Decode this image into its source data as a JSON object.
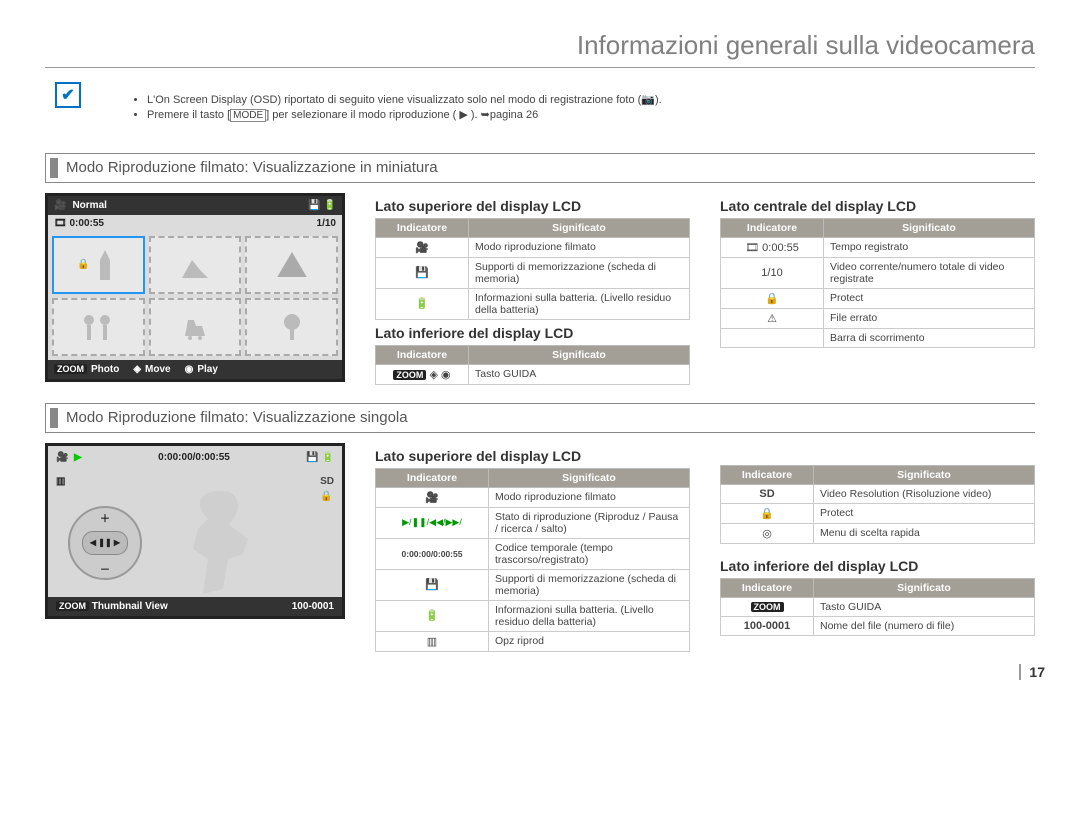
{
  "header": "Informazioni generali sulla videocamera",
  "notes": {
    "l1": "L'On Screen Display (OSD) riportato di seguito viene visualizzato solo nel modo di registrazione foto (📷).",
    "l2_a": "Premere il tasto [",
    "l2_mode": "MODE",
    "l2_b": "] per selezionare il modo riproduzione ( ▶ ). ➥pagina 26"
  },
  "section1": "Modo Riproduzione filmato: Visualizzazione in miniatura",
  "section2": "Modo Riproduzione filmato: Visualizzazione singola",
  "lcd1": {
    "mode": "Normal",
    "time": "0:00:55",
    "count": "1/10",
    "photo": "Photo",
    "move": "Move",
    "play": "Play",
    "zoom": "ZOOM"
  },
  "lcd2": {
    "time": "0:00:00/0:00:55",
    "sd": "SD",
    "thumb": "Thumbnail View",
    "file": "100-0001",
    "zoom": "ZOOM"
  },
  "labels": {
    "latoSup": "Lato superiore del display LCD",
    "latoInf": "Lato inferiore del display LCD",
    "latoCen": "Lato centrale del display LCD",
    "th_ind": "Indicatore",
    "th_sig": "Significato"
  },
  "t1_sup": [
    {
      "i": "🎥",
      "s": "Modo riproduzione filmato"
    },
    {
      "i": "💾",
      "s": "Supporti di memorizzazione (scheda di memoria)"
    },
    {
      "i": "🔋",
      "s": "Informazioni sulla batteria. (Livello residuo della batteria)"
    }
  ],
  "t1_inf": [
    {
      "i": "ZOOM ◈ ◉",
      "s": "Tasto GUIDA"
    }
  ],
  "t1_cen": [
    {
      "i": "🎞 0:00:55",
      "s": "Tempo registrato"
    },
    {
      "i": "1/10",
      "s": "Video corrente/numero totale di video registrate"
    },
    {
      "i": "🔒",
      "s": "Protect"
    },
    {
      "i": "⚠",
      "s": "File errato"
    },
    {
      "i": "",
      "s": "Barra di scorrimento"
    }
  ],
  "t2_sup": [
    {
      "i": "🎥",
      "s": "Modo riproduzione filmato"
    },
    {
      "i": "▶/❚❚/◀◀/▶▶/",
      "s": "Stato di riproduzione (Riproduz / Pausa / ricerca / salto)"
    },
    {
      "i": "0:00:00/0:00:55",
      "s": "Codice temporale (tempo trascorso/registrato)"
    },
    {
      "i": "💾",
      "s": "Supporti di memorizzazione (scheda di memoria)"
    },
    {
      "i": "🔋",
      "s": "Informazioni sulla batteria. (Livello residuo della batteria)"
    },
    {
      "i": "▥",
      "s": "Opz riprod"
    }
  ],
  "t2_cen": [
    {
      "i": "SD",
      "s": "Video Resolution (Risoluzione video)"
    },
    {
      "i": "🔒",
      "s": "Protect"
    },
    {
      "i": "◎",
      "s": "Menu di scelta rapida"
    }
  ],
  "t2_inf": [
    {
      "i": "ZOOM",
      "s": "Tasto GUIDA"
    },
    {
      "i": "100-0001",
      "s": "Nome del file (numero di file)"
    }
  ],
  "pagenum": "17"
}
